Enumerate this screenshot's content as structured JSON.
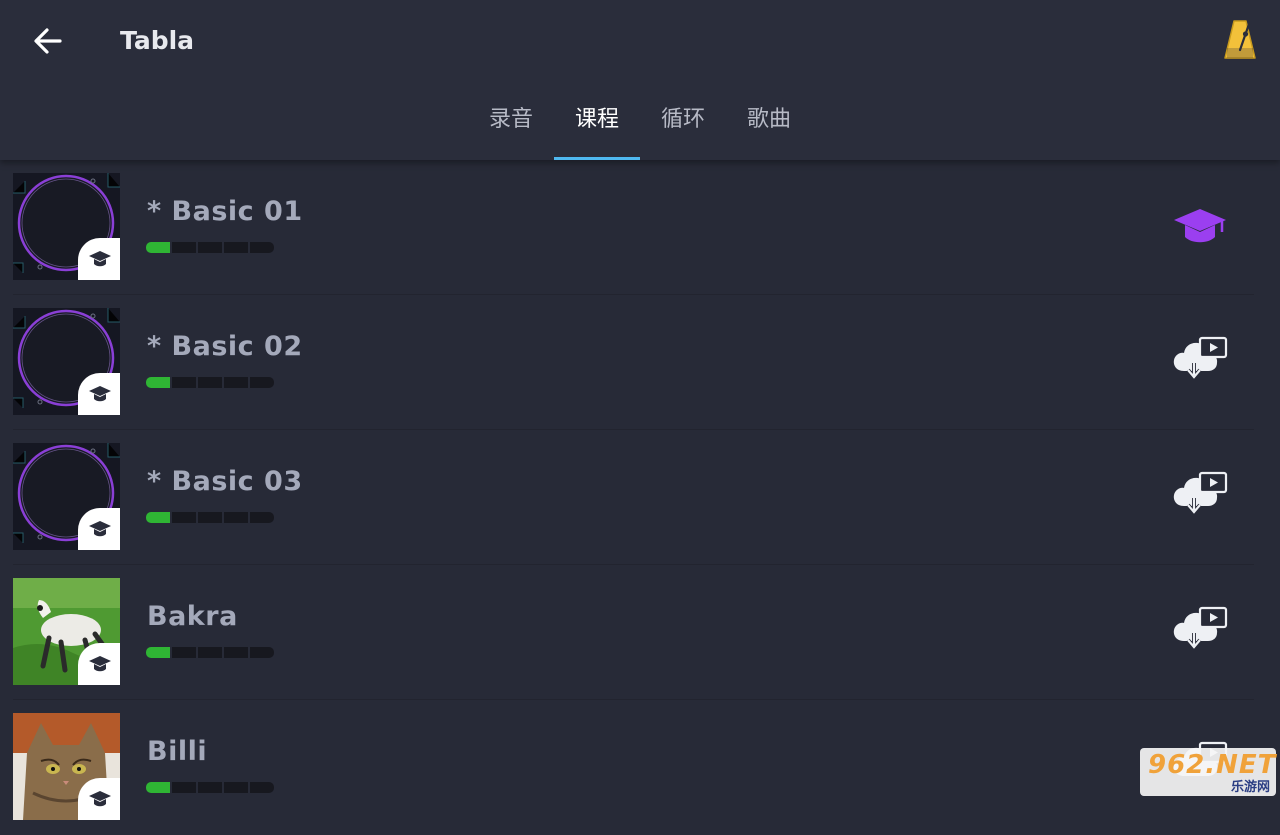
{
  "header": {
    "title": "Tabla",
    "back_icon": "arrow-left-icon",
    "metronome_icon": "metronome-icon"
  },
  "tabs": [
    {
      "label": "录音",
      "active": false
    },
    {
      "label": "课程",
      "active": true
    },
    {
      "label": "循环",
      "active": false
    },
    {
      "label": "歌曲",
      "active": false
    }
  ],
  "lessons": [
    {
      "name": "* Basic 01",
      "thumbnail": "tabla-drum-thumbnail",
      "progress": 0.2,
      "action_icon": "graduation-cap-icon"
    },
    {
      "name": "* Basic 02",
      "thumbnail": "tabla-drum-thumbnail",
      "progress": 0.2,
      "action_icon": "cloud-download-video-icon"
    },
    {
      "name": "* Basic 03",
      "thumbnail": "tabla-drum-thumbnail",
      "progress": 0.2,
      "action_icon": "cloud-download-video-icon"
    },
    {
      "name": "Bakra",
      "thumbnail": "goat-photo-thumbnail",
      "progress": 0.2,
      "action_icon": "cloud-download-video-icon"
    },
    {
      "name": "Billi",
      "thumbnail": "cat-photo-thumbnail",
      "progress": 0.2,
      "action_icon": "cloud-download-video-icon"
    }
  ],
  "colors": {
    "background": "#272a37",
    "progress_fill": "#2fb534",
    "tab_indicator": "#4fb8f0",
    "lesson_icon": "#9b3ff0",
    "metronome": "#f3c13a"
  },
  "watermark": {
    "top": "962.NET",
    "bottom": "乐游网"
  }
}
